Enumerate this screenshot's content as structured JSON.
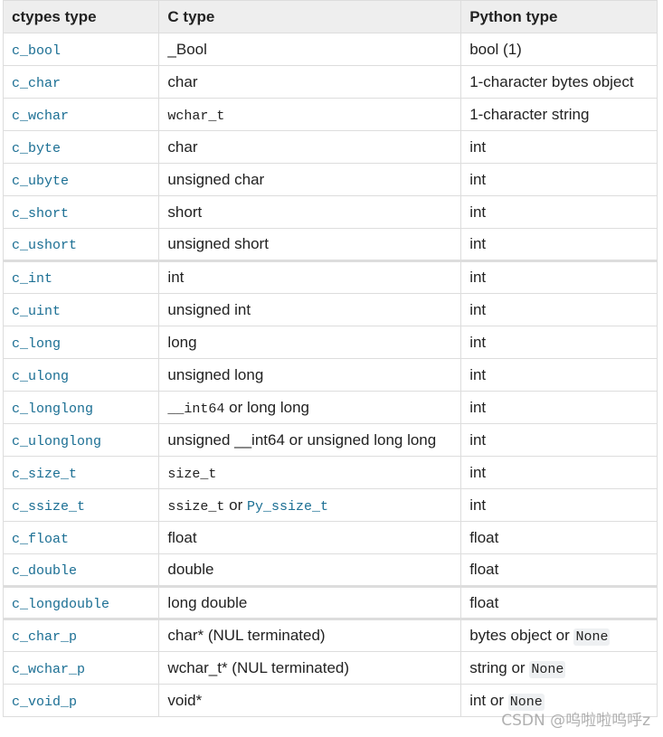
{
  "headers": [
    "ctypes type",
    "C type",
    "Python type"
  ],
  "rows": [
    {
      "ctype": "c_bool",
      "c": [
        {
          "t": "_Bool",
          "k": "text"
        }
      ],
      "py": [
        {
          "t": "bool (1)",
          "k": "text"
        }
      ]
    },
    {
      "ctype": "c_char",
      "c": [
        {
          "t": "char",
          "k": "text"
        }
      ],
      "py": [
        {
          "t": "1-character bytes object",
          "k": "text"
        }
      ]
    },
    {
      "ctype": "c_wchar",
      "c": [
        {
          "t": "wchar_t",
          "k": "mono"
        }
      ],
      "py": [
        {
          "t": "1-character string",
          "k": "text"
        }
      ]
    },
    {
      "ctype": "c_byte",
      "c": [
        {
          "t": "char",
          "k": "text"
        }
      ],
      "py": [
        {
          "t": "int",
          "k": "text"
        }
      ]
    },
    {
      "ctype": "c_ubyte",
      "c": [
        {
          "t": "unsigned char",
          "k": "text"
        }
      ],
      "py": [
        {
          "t": "int",
          "k": "text"
        }
      ]
    },
    {
      "ctype": "c_short",
      "c": [
        {
          "t": "short",
          "k": "text"
        }
      ],
      "py": [
        {
          "t": "int",
          "k": "text"
        }
      ]
    },
    {
      "ctype": "c_ushort",
      "c": [
        {
          "t": "unsigned short",
          "k": "text"
        }
      ],
      "py": [
        {
          "t": "int",
          "k": "text"
        }
      ]
    },
    {
      "ctype": "c_int",
      "c": [
        {
          "t": "int",
          "k": "text"
        }
      ],
      "py": [
        {
          "t": "int",
          "k": "text"
        }
      ],
      "thick": true
    },
    {
      "ctype": "c_uint",
      "c": [
        {
          "t": "unsigned int",
          "k": "text"
        }
      ],
      "py": [
        {
          "t": "int",
          "k": "text"
        }
      ]
    },
    {
      "ctype": "c_long",
      "c": [
        {
          "t": "long",
          "k": "text"
        }
      ],
      "py": [
        {
          "t": "int",
          "k": "text"
        }
      ]
    },
    {
      "ctype": "c_ulong",
      "c": [
        {
          "t": "unsigned long",
          "k": "text"
        }
      ],
      "py": [
        {
          "t": "int",
          "k": "text"
        }
      ]
    },
    {
      "ctype": "c_longlong",
      "c": [
        {
          "t": "__int64",
          "k": "mono"
        },
        {
          "t": " or long long",
          "k": "text"
        }
      ],
      "py": [
        {
          "t": "int",
          "k": "text"
        }
      ]
    },
    {
      "ctype": "c_ulonglong",
      "c": [
        {
          "t": "unsigned __int64 or unsigned long long",
          "k": "text"
        }
      ],
      "py": [
        {
          "t": "int",
          "k": "text"
        }
      ]
    },
    {
      "ctype": "c_size_t",
      "c": [
        {
          "t": "size_t",
          "k": "mono"
        }
      ],
      "py": [
        {
          "t": "int",
          "k": "text"
        }
      ]
    },
    {
      "ctype": "c_ssize_t",
      "c": [
        {
          "t": "ssize_t",
          "k": "mono"
        },
        {
          "t": " or ",
          "k": "text"
        },
        {
          "t": "Py_ssize_t",
          "k": "link"
        }
      ],
      "py": [
        {
          "t": "int",
          "k": "text"
        }
      ]
    },
    {
      "ctype": "c_float",
      "c": [
        {
          "t": "float",
          "k": "text"
        }
      ],
      "py": [
        {
          "t": "float",
          "k": "text"
        }
      ]
    },
    {
      "ctype": "c_double",
      "c": [
        {
          "t": "double",
          "k": "text"
        }
      ],
      "py": [
        {
          "t": "float",
          "k": "text"
        }
      ]
    },
    {
      "ctype": "c_longdouble",
      "c": [
        {
          "t": "long double",
          "k": "text"
        }
      ],
      "py": [
        {
          "t": "float",
          "k": "text"
        }
      ],
      "thick": true
    },
    {
      "ctype": "c_char_p",
      "c": [
        {
          "t": "char* (NUL terminated)",
          "k": "text"
        }
      ],
      "py": [
        {
          "t": "bytes object or ",
          "k": "text"
        },
        {
          "t": "None",
          "k": "literal"
        }
      ],
      "thick": true
    },
    {
      "ctype": "c_wchar_p",
      "c": [
        {
          "t": "wchar_t* (NUL terminated)",
          "k": "text"
        }
      ],
      "py": [
        {
          "t": "string or ",
          "k": "text"
        },
        {
          "t": "None",
          "k": "literal"
        }
      ]
    },
    {
      "ctype": "c_void_p",
      "c": [
        {
          "t": "void*",
          "k": "text"
        }
      ],
      "py": [
        {
          "t": "int or ",
          "k": "text"
        },
        {
          "t": "None",
          "k": "literal"
        }
      ]
    }
  ],
  "watermark": "CSDN @呜啦啦呜呼z",
  "colors": {
    "link": "#1a6e93",
    "header_bg": "#eeeeee",
    "border": "#dddddd",
    "text": "#222222"
  }
}
